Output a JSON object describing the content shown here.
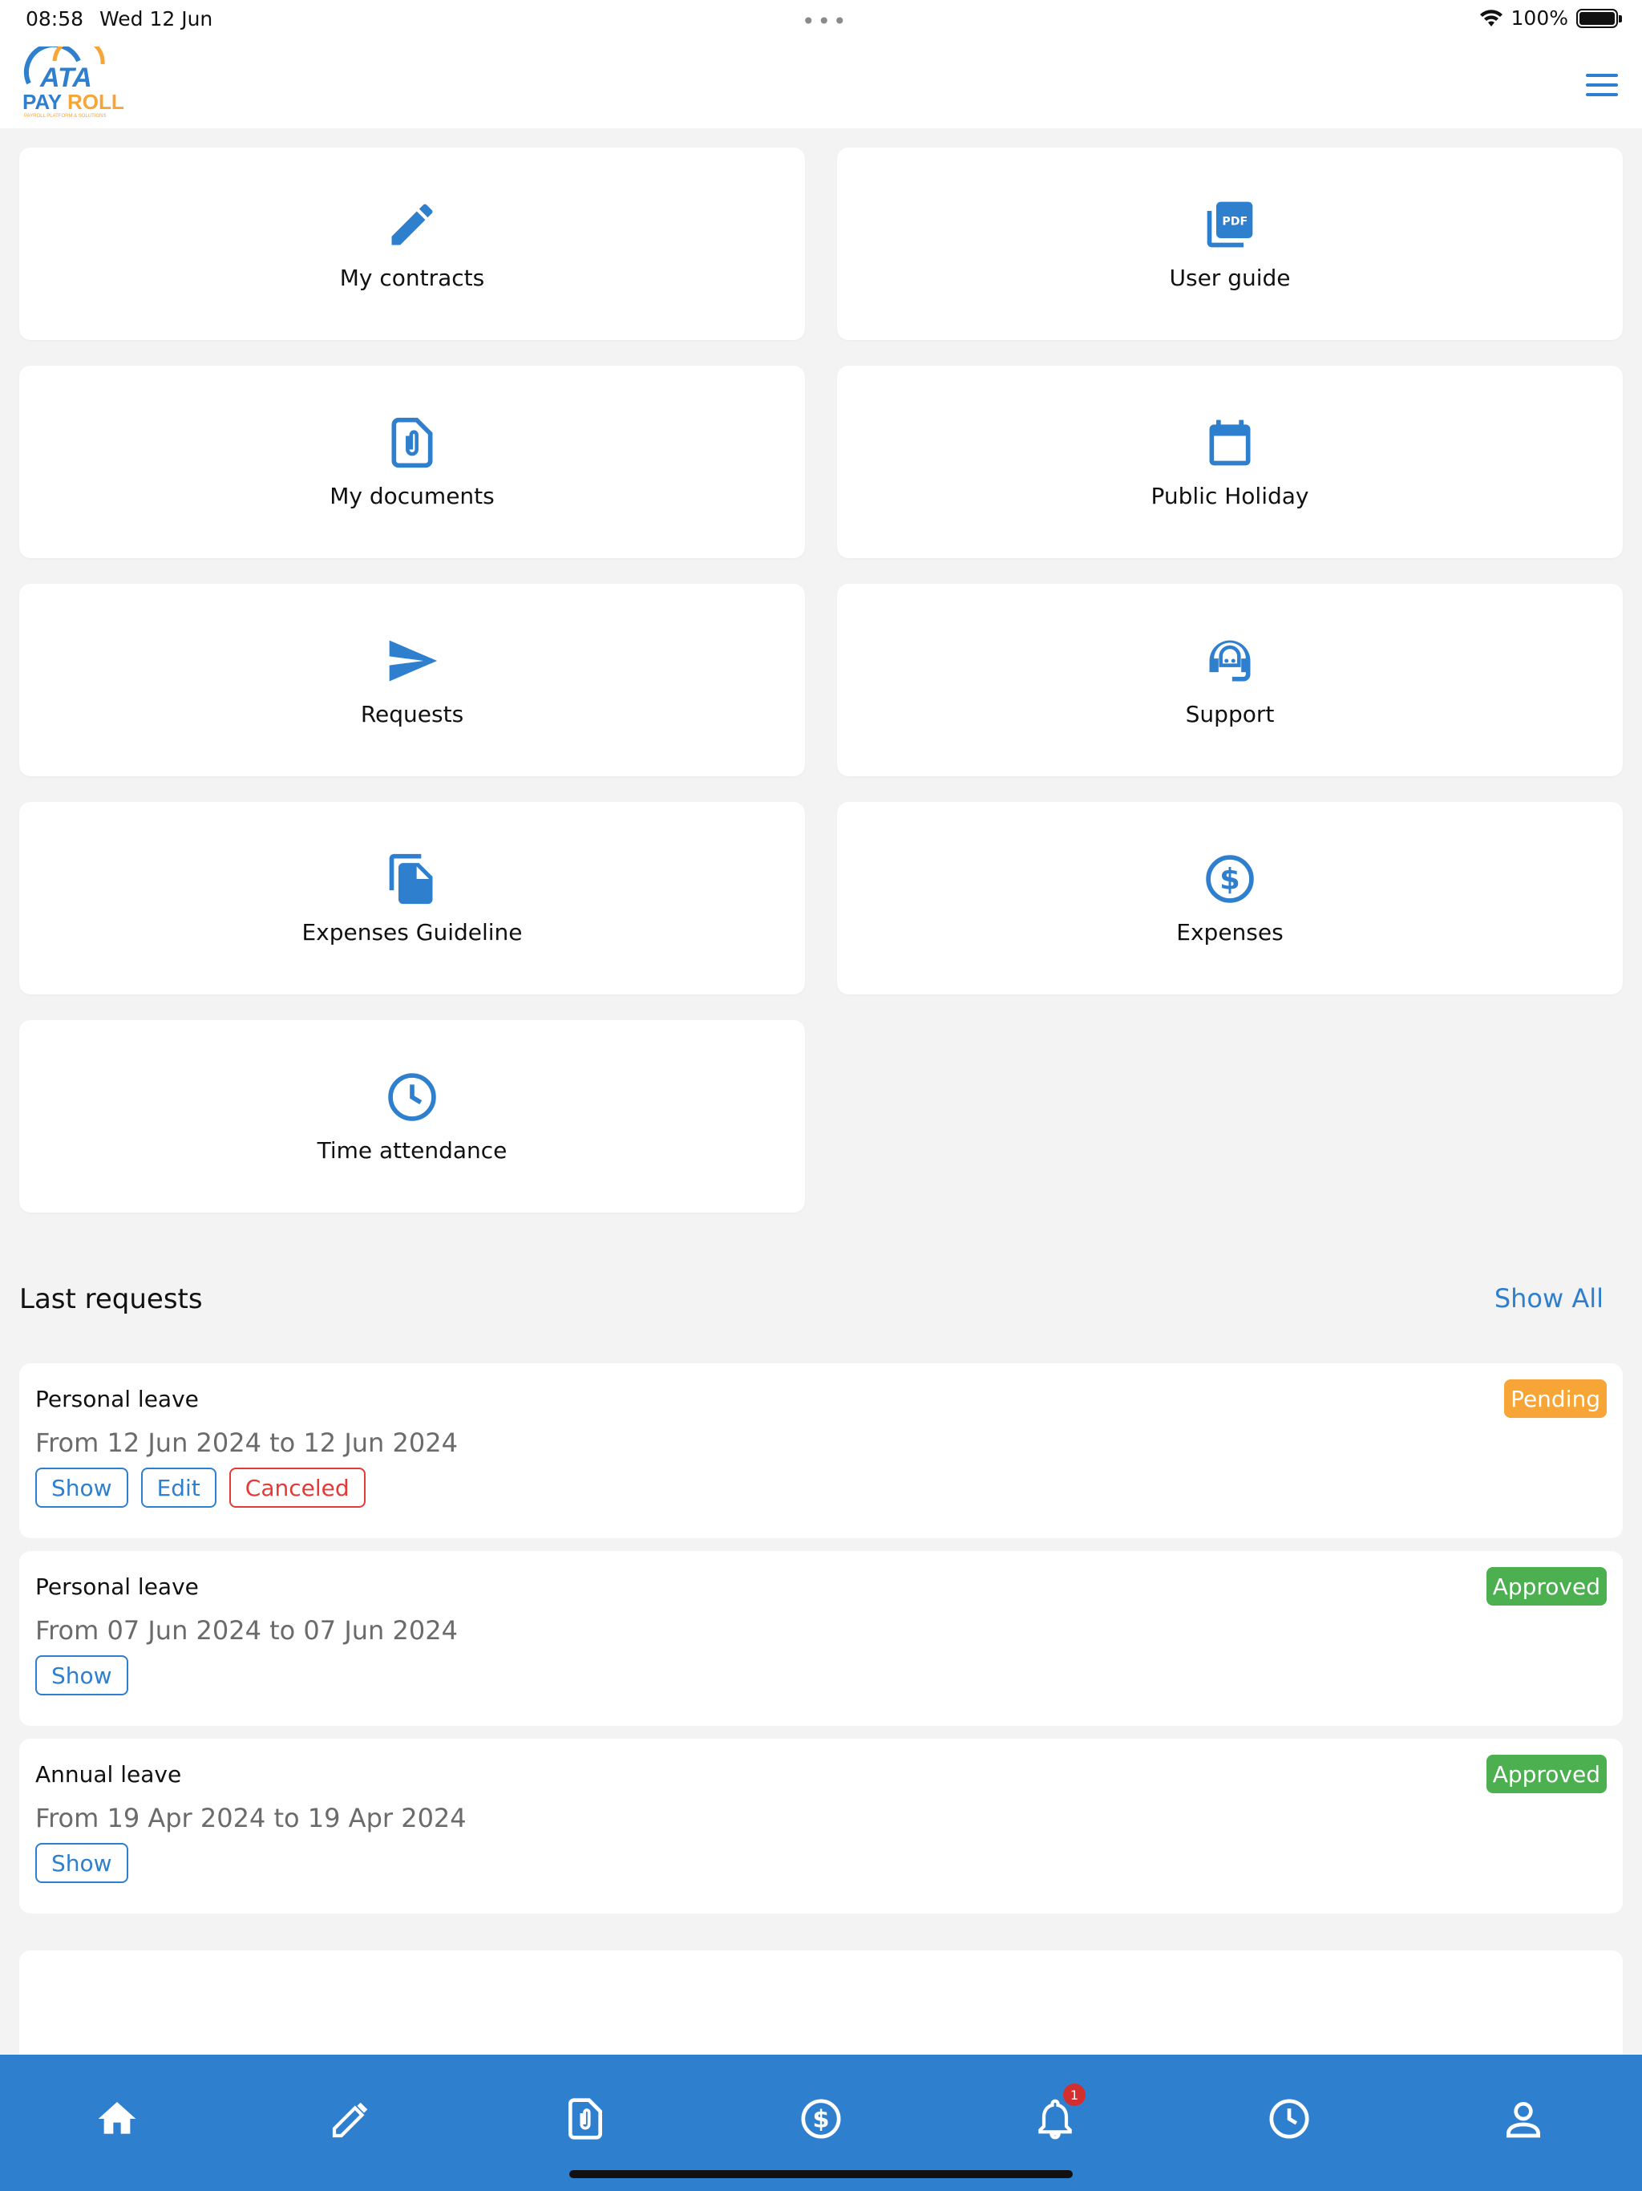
{
  "status_bar": {
    "time": "08:58",
    "date": "Wed 12 Jun",
    "battery": "100%"
  },
  "header": {
    "logo_text_top": "ATA",
    "logo_text_bottom": "PAYROLL",
    "logo_tagline": "PAYROLL PLATFORM & SOLUTIONS",
    "menu_icon": "hamburger-icon"
  },
  "tiles": [
    {
      "label": "My contracts",
      "icon": "pencil-icon"
    },
    {
      "label": "User guide",
      "icon": "pdf-icon"
    },
    {
      "label": "My documents",
      "icon": "paperclip-document-icon"
    },
    {
      "label": "Public Holiday",
      "icon": "calendar-icon"
    },
    {
      "label": "Requests",
      "icon": "send-icon"
    },
    {
      "label": "Support",
      "icon": "headset-icon"
    },
    {
      "label": "Expenses Guideline",
      "icon": "file-copy-icon"
    },
    {
      "label": "Expenses",
      "icon": "dollar-circle-icon"
    },
    {
      "label": "Time attendance",
      "icon": "clock-icon"
    }
  ],
  "last_requests": {
    "title": "Last requests",
    "show_all_label": "Show All",
    "items": [
      {
        "title": "Personal leave",
        "dates": "From 12 Jun 2024 to 12 Jun 2024",
        "status": "Pending",
        "status_color": "#f7a536",
        "actions": [
          "Show",
          "Edit",
          "Canceled"
        ]
      },
      {
        "title": "Personal leave",
        "dates": "From 07 Jun 2024 to 07 Jun 2024",
        "status": "Approved",
        "status_color": "#4caf50",
        "actions": [
          "Show"
        ]
      },
      {
        "title": "Annual leave",
        "dates": "From 19 Apr 2024 to 19 Apr 2024",
        "status": "Approved",
        "status_color": "#4caf50",
        "actions": [
          "Show"
        ]
      }
    ]
  },
  "tab_bar": {
    "items": [
      "home-icon",
      "pencil-icon",
      "document-icon",
      "dollar-circle-icon",
      "bell-icon",
      "clock-icon",
      "person-icon"
    ],
    "notification_count": "1"
  },
  "colors": {
    "accent": "#2f7fcf",
    "background": "#f3f3f3",
    "danger": "#e53935"
  }
}
